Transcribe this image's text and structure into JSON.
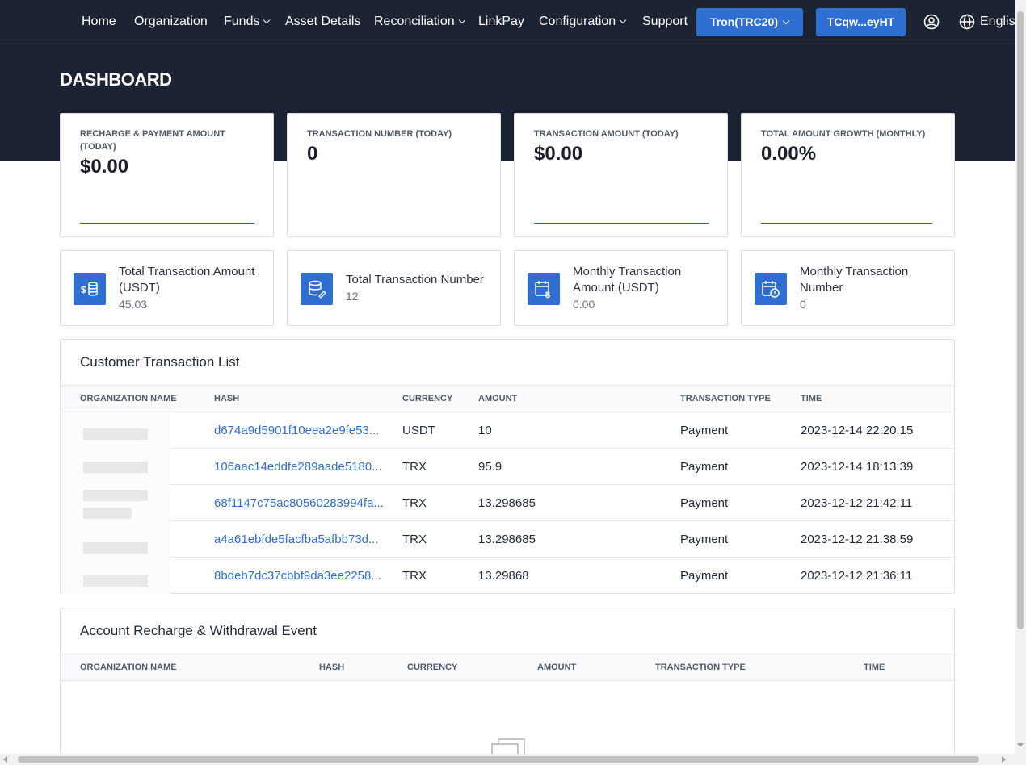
{
  "nav": {
    "items": [
      {
        "label": "Home",
        "dropdown": false
      },
      {
        "label": "Organization",
        "dropdown": false
      },
      {
        "label": "Funds",
        "dropdown": true
      },
      {
        "label": "Asset Details",
        "dropdown": false
      },
      {
        "label": "Reconciliation",
        "dropdown": true
      },
      {
        "label": "LinkPay",
        "dropdown": false
      },
      {
        "label": "Configuration",
        "dropdown": true
      },
      {
        "label": "Support",
        "dropdown": false
      }
    ],
    "network_select": "Tron(TRC20)",
    "wallet_button": "TCqw...eyHT",
    "user_icon": "user-circle-icon",
    "language": "English",
    "language_icon": "globe-icon"
  },
  "page": {
    "title": "DASHBOARD"
  },
  "stats": [
    {
      "label": "RECHARGE & PAYMENT AMOUNT (TODAY)",
      "value": "$0.00",
      "has_line": true
    },
    {
      "label": "TRANSACTION NUMBER (TODAY)",
      "value": "0",
      "has_line": false
    },
    {
      "label": "TRANSACTION AMOUNT (TODAY)",
      "value": "$0.00",
      "has_line": true
    },
    {
      "label": "TOTAL AMOUNT GROWTH (MONTHLY)",
      "value": "0.00%",
      "has_line": true
    }
  ],
  "metrics": [
    {
      "label": "Total Transaction Amount (USDT)",
      "value": "45.03",
      "icon": "dollar-coins-icon"
    },
    {
      "label": "Total Transaction Number",
      "value": "12",
      "icon": "database-edit-icon"
    },
    {
      "label": "Monthly Transaction Amount (USDT)",
      "value": "0.00",
      "icon": "calendar-dollar-icon"
    },
    {
      "label": "Monthly Transaction Number",
      "value": "0",
      "icon": "calendar-clock-icon"
    }
  ],
  "customer_transactions": {
    "title": "Customer Transaction List",
    "columns": [
      "ORGANIZATION NAME",
      "HASH",
      "CURRENCY",
      "AMOUNT",
      "TRANSACTION TYPE",
      "TIME"
    ],
    "rows": [
      {
        "hash": "d674a9d5901f10eea2e9fe53...",
        "currency": "USDT",
        "amount": "10",
        "type": "Payment",
        "time": "2023-12-14 22:20:15"
      },
      {
        "hash": "106aac14eddfe289aade5180...",
        "currency": "TRX",
        "amount": "95.9",
        "type": "Payment",
        "time": "2023-12-14 18:13:39"
      },
      {
        "hash": "68f1147c75ac80560283994fa...",
        "currency": "TRX",
        "amount": "13.298685",
        "type": "Payment",
        "time": "2023-12-12 21:42:11"
      },
      {
        "hash": "a4a61ebfde5facfba5afbb73d...",
        "currency": "TRX",
        "amount": "13.298685",
        "type": "Payment",
        "time": "2023-12-12 21:38:59"
      },
      {
        "hash": "8bdeb7dc37cbbf9da3ee2258...",
        "currency": "TRX",
        "amount": "13.29868",
        "type": "Payment",
        "time": "2023-12-12 21:36:11"
      }
    ]
  },
  "recharge_events": {
    "title": "Account Recharge & Withdrawal Event",
    "columns": [
      "ORGANIZATION NAME",
      "HASH",
      "CURRENCY",
      "AMOUNT",
      "TRANSACTION TYPE",
      "TIME"
    ],
    "empty_icon": "empty-box-icon"
  },
  "colors": {
    "accent": "#2f6fd1",
    "header_bg": "#1c2333",
    "link": "#2f6fd1"
  }
}
